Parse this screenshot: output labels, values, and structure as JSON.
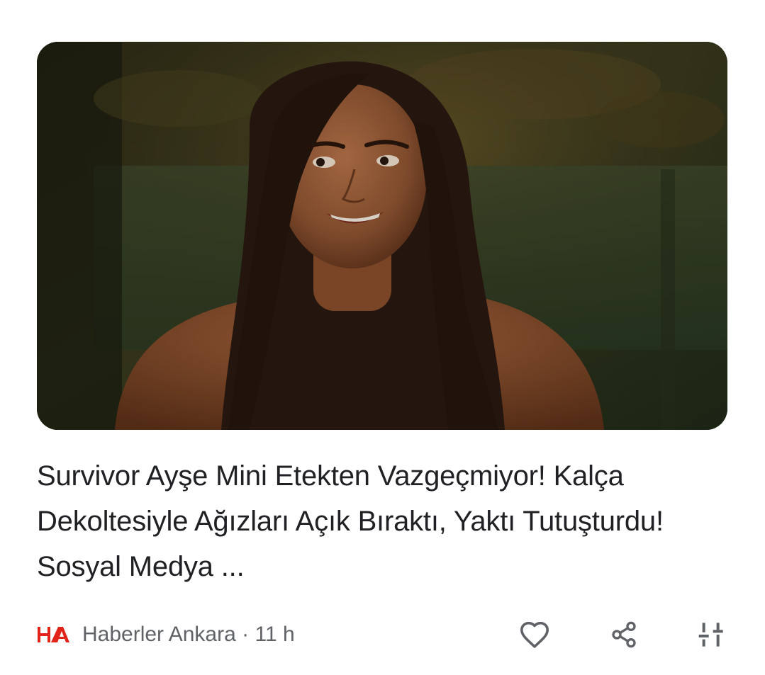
{
  "article": {
    "image_alt": "Survivor Ayşe",
    "headline": "Survivor Ayşe Mini Etekten Vazgeçmiyor! Kalça Dekoltesiyle Ağızları Açık Bıraktı, Yaktı Tutuşturdu! Sosyal Medya ...",
    "source": {
      "logo_text": "HA",
      "name": "Haberler Ankara",
      "separator": "·",
      "time": "11 h"
    }
  },
  "actions": {
    "like_icon": "heart-outline-icon",
    "share_icon": "share-icon",
    "more_icon": "tune-icon"
  },
  "colors": {
    "text_primary": "#202124",
    "text_secondary": "#5f6368",
    "brand_red": "#e2231a",
    "icon": "#5f6368"
  }
}
